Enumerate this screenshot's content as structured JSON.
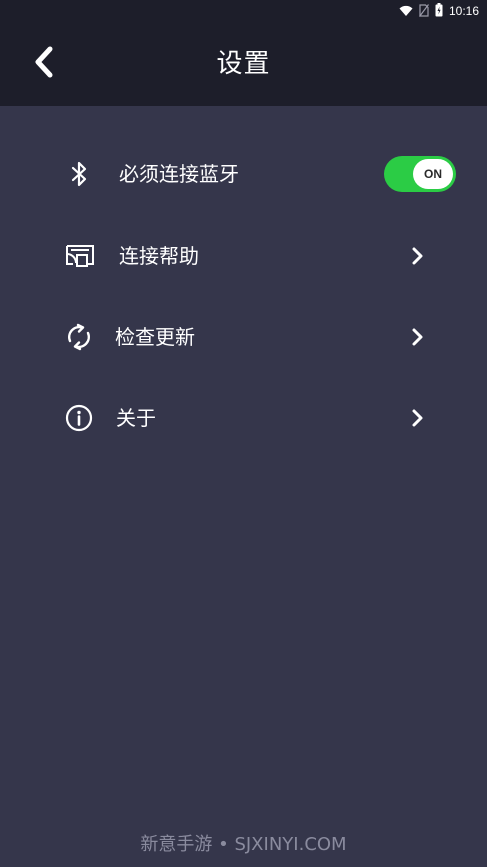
{
  "status_bar": {
    "time": "10:16"
  },
  "header": {
    "title": "设置",
    "back_icon": "chevron-left-icon"
  },
  "settings": {
    "items": [
      {
        "label": "必须连接蓝牙",
        "icon": "bluetooth-icon",
        "control": "toggle",
        "toggle_text": "ON",
        "toggle_on": true
      },
      {
        "label": "连接帮助",
        "icon": "screen-cast-icon",
        "control": "chevron"
      },
      {
        "label": "检查更新",
        "icon": "refresh-icon",
        "control": "chevron"
      },
      {
        "label": "关于",
        "icon": "info-icon",
        "control": "chevron"
      }
    ]
  },
  "colors": {
    "background": "#35364b",
    "header": "#1d1e2a",
    "toggle_on": "#2bcc45",
    "text": "#ffffff",
    "watermark": "#8a8b9e"
  },
  "watermark": "新意手游 • SJXINYI.COM"
}
